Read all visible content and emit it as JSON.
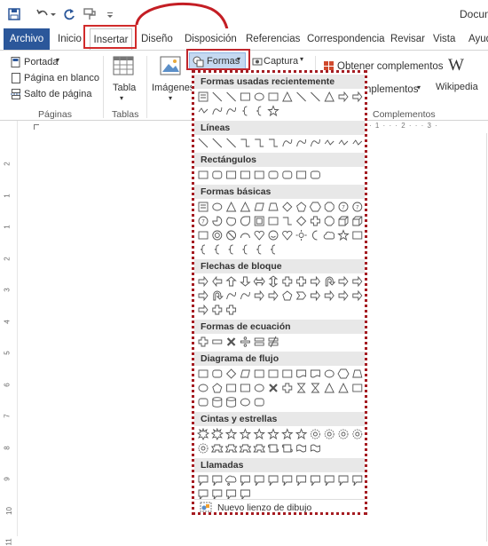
{
  "window": {
    "doc_title": "Docum"
  },
  "tabs": [
    {
      "label": "Archivo"
    },
    {
      "label": "Inicio"
    },
    {
      "label": "Insertar"
    },
    {
      "label": "Diseño"
    },
    {
      "label": "Disposición"
    },
    {
      "label": "Referencias"
    },
    {
      "label": "Correspondencia"
    },
    {
      "label": "Revisar"
    },
    {
      "label": "Vista"
    },
    {
      "label": "Ayud"
    }
  ],
  "ribbon": {
    "paginas": {
      "portada": "Portada",
      "pagina_blanco": "Página en blanco",
      "salto": "Salto de página",
      "label": "Páginas"
    },
    "tablas": {
      "tabla": "Tabla",
      "label": "Tablas"
    },
    "ilustraciones": {
      "imagenes": "Imágenes",
      "formas": "Formas",
      "captura": "Captura"
    },
    "complementos": {
      "obtener": "Obtener complementos",
      "mis": "nplementos",
      "wikipedia": "Wikipedia",
      "wikipedia_logo": "W",
      "label": "Complementos"
    }
  },
  "dropdown": {
    "sections": [
      {
        "title": "Formas usadas recientemente"
      },
      {
        "title": "Líneas"
      },
      {
        "title": "Rectángulos"
      },
      {
        "title": "Formas básicas"
      },
      {
        "title": "Flechas de bloque"
      },
      {
        "title": "Formas de ecuación"
      },
      {
        "title": "Diagrama de flujo"
      },
      {
        "title": "Cintas y estrellas"
      },
      {
        "title": "Llamadas"
      }
    ],
    "new_canvas": "Nuevo lienzo de dibujo"
  },
  "ruler": {
    "numbers": [
      "2",
      "1",
      "1",
      "2",
      "3",
      "4",
      "5",
      "6",
      "7",
      "8",
      "9",
      "10",
      "11"
    ]
  },
  "hruler_tail": "· 1 · · · 2 · · · 3 ·",
  "colors": {
    "accent": "#2b579a",
    "highlight": "#d12b2b",
    "selected": "#c5d9f1"
  }
}
